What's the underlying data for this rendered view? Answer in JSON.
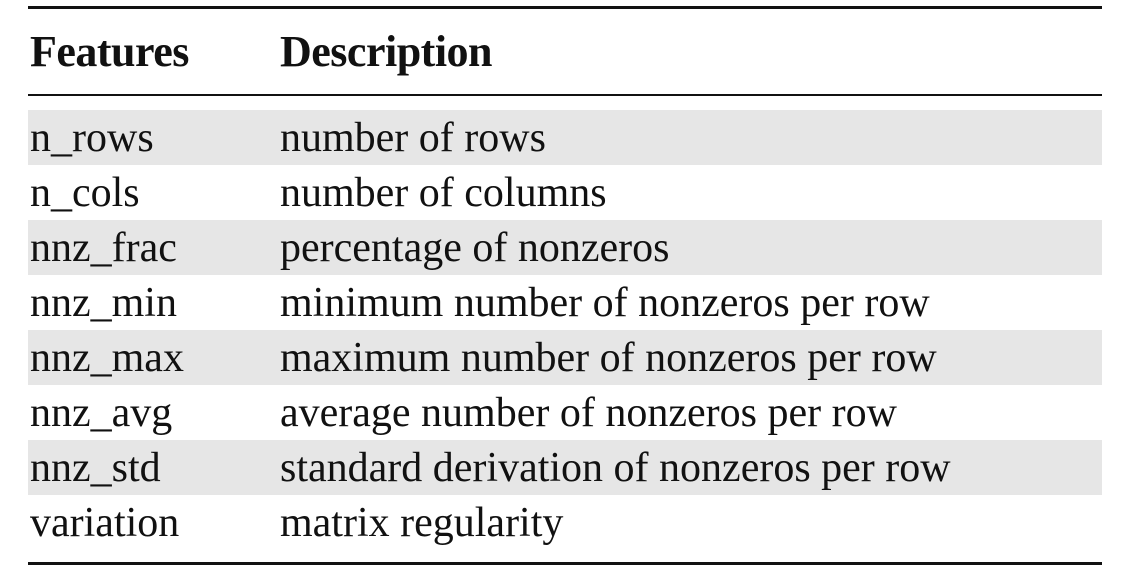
{
  "table": {
    "headers": {
      "feature": "Features",
      "description": "Description"
    },
    "rows": [
      {
        "feature": "n_rows",
        "description": "number of rows"
      },
      {
        "feature": "n_cols",
        "description": "number of columns"
      },
      {
        "feature": "nnz_frac",
        "description": "percentage of nonzeros"
      },
      {
        "feature": "nnz_min",
        "description": "minimum number of nonzeros per row"
      },
      {
        "feature": "nnz_max",
        "description": "maximum number of nonzeros per row"
      },
      {
        "feature": "nnz_avg",
        "description": "average number of nonzeros per row"
      },
      {
        "feature": "nnz_std",
        "description": "standard derivation of nonzeros per row"
      },
      {
        "feature": "variation",
        "description": "matrix regularity"
      }
    ],
    "shade_color": "#e6e6e6"
  }
}
